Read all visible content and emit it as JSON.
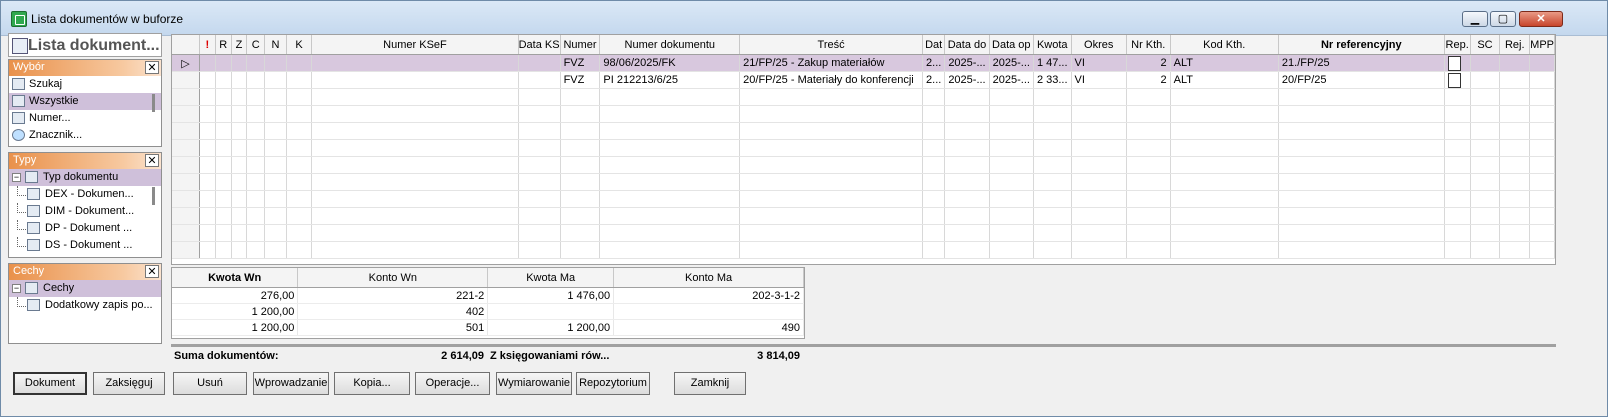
{
  "window": {
    "title": "Lista dokumentów w buforze"
  },
  "left": {
    "panel_title": "Lista dokument...",
    "sections": [
      {
        "title": "Wybór",
        "close": "✕",
        "items": [
          {
            "label": "Szukaj",
            "icon": "binoculars-icon",
            "selected": false
          },
          {
            "label": "Wszystkie",
            "icon": "list-icon",
            "selected": true
          },
          {
            "label": "Numer...",
            "icon": "list-icon",
            "selected": false
          },
          {
            "label": "Znacznik...",
            "icon": "marker-icon",
            "selected": false
          }
        ]
      },
      {
        "title": "Typy",
        "close": "✕",
        "root": "Typ dokumentu",
        "items": [
          {
            "label": "DEX - Dokumen..."
          },
          {
            "label": "DIM - Dokument..."
          },
          {
            "label": "DP - Dokument ..."
          },
          {
            "label": "DS - Dokument ..."
          }
        ]
      },
      {
        "title": "Cechy",
        "close": "✕",
        "root": "Cechy",
        "items": [
          {
            "label": "Dodatkowy zapis po..."
          }
        ]
      }
    ]
  },
  "grid": {
    "columns": [
      "!",
      "R",
      "Z",
      "C",
      "N",
      "K",
      "Numer KSeF",
      "Data KS",
      "Numer",
      "Numer dokumentu",
      "Treść",
      "Dat",
      "Data do",
      "Data op",
      "Kwota",
      "Okres",
      "Nr Kth.",
      "Kod Kth.",
      "Nr referencyjny",
      "Rep.",
      "SC",
      "Rej.",
      "MPP"
    ],
    "rows": [
      {
        "indicator": "▷",
        "selected": true,
        "numer": "FVZ",
        "numer_dokumentu": "98/06/2025/FK",
        "tresc": "21/FP/25 - Zakup materiałów",
        "dat": "2...",
        "data_do": "2025-...",
        "data_op": "2025-...",
        "kwota": "1 47...",
        "okres": "VI",
        "nr_kth": "2",
        "kod_kth": "ALT",
        "nr_ref": "21./FP/25"
      },
      {
        "indicator": "",
        "selected": false,
        "numer": "FVZ",
        "numer_dokumentu": "PI 212213/6/25",
        "tresc": "20/FP/25 - Materiały do konferencji",
        "dat": "2...",
        "data_do": "2025-...",
        "data_op": "2025-...",
        "kwota": "2 33...",
        "okres": "VI",
        "nr_kth": "2",
        "kod_kth": "ALT",
        "nr_ref": "20/FP/25"
      }
    ]
  },
  "entries": {
    "columns": [
      "Kwota Wn",
      "Konto Wn",
      "Kwota Ma",
      "Konto Ma"
    ],
    "rows": [
      {
        "kwota_wn": "276,00",
        "konto_wn": "221-2",
        "kwota_ma": "1 476,00",
        "konto_ma": "202-3-1-2"
      },
      {
        "kwota_wn": "1 200,00",
        "konto_wn": "402",
        "kwota_ma": "",
        "konto_ma": ""
      },
      {
        "kwota_wn": "1 200,00",
        "konto_wn": "501",
        "kwota_ma": "1 200,00",
        "konto_ma": "490"
      }
    ]
  },
  "summary": {
    "label": "Suma dokumentów:",
    "value": "2 614,09",
    "label2": "Z księgowaniami rów...",
    "value2": "3 814,09"
  },
  "buttons": [
    "Dokument",
    "Zaksięguj",
    "Usuń",
    "Wprowadzanie",
    "Kopia...",
    "Operacje...",
    "Wymiarowanie",
    "Repozytorium",
    "Zamknij"
  ]
}
